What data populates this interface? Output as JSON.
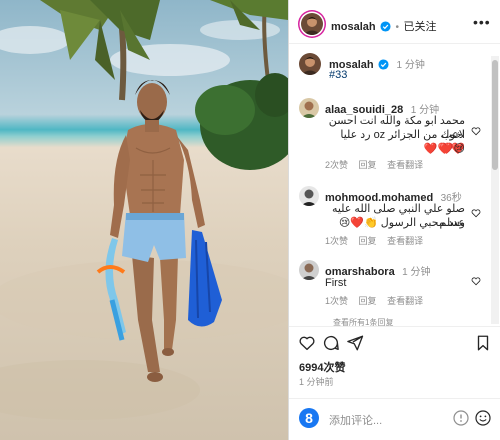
{
  "colors": {
    "accent": "#0095f6",
    "heart_red": "#ed4956",
    "muted": "#8e8e8e",
    "verified": "#0095f6"
  },
  "header": {
    "username": "mosalah",
    "separator": "•",
    "follow_status": "已关注",
    "more_icon": "more-horizontal-icon"
  },
  "caption": {
    "username": "mosalah",
    "time": "1 分钟",
    "text": "#33"
  },
  "comments": [
    {
      "username": "alaa_souidi_28",
      "time": "1 分钟",
      "text_line1": "محمد ابو مكة والله انت احسن لاعب",
      "text_line2": "اخوك من الجزائر oz رد عليا ❤️❤️❤️",
      "text_line3": "😢❤️",
      "likes": "2次赞",
      "reply": "回复",
      "translate": "查看翻译"
    },
    {
      "username": "mohmood.mohamed",
      "time": "36秒",
      "text_line1": "صلو علي النبي صلى الله عليه وسلم",
      "text_line2": "عدد محبي الرسول 👏❤️😢",
      "likes": "1次赞",
      "reply": "回复",
      "translate": "查看翻译"
    },
    {
      "username": "omarshabora",
      "time": "1 分钟",
      "text_line1": "First",
      "likes": "1次赞",
      "reply": "回复",
      "translate": "查看翻译"
    }
  ],
  "more_replies_hint": "查看所有1条回复",
  "actions": {
    "like_icon": "heart-icon",
    "comment_icon": "comment-icon",
    "share_icon": "send-icon",
    "save_icon": "bookmark-icon"
  },
  "likes_count": "6994次赞",
  "post_time": "1 分钟前",
  "comment_box": {
    "placeholder": "添加评论...",
    "emoji_icon": "emoji-icon",
    "post_icon": "post-icon"
  }
}
